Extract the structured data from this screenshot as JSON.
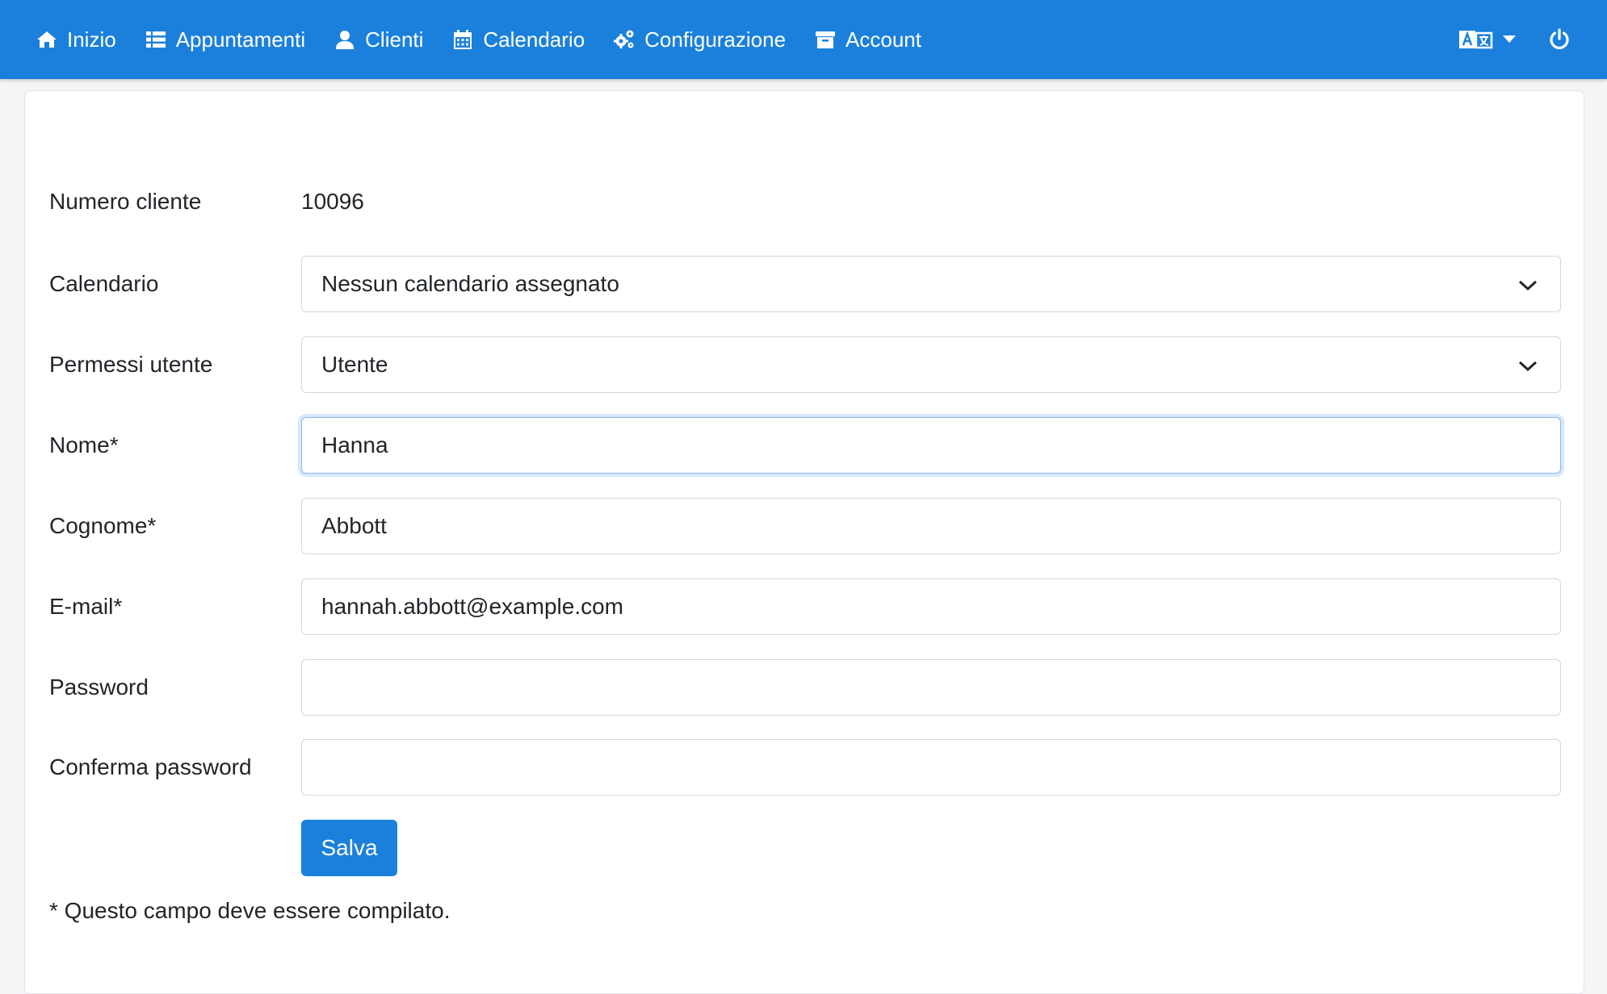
{
  "nav": {
    "items": [
      {
        "label": "Inizio",
        "icon": "home-icon"
      },
      {
        "label": "Appuntamenti",
        "icon": "list-icon"
      },
      {
        "label": "Clienti",
        "icon": "user-icon"
      },
      {
        "label": "Calendario",
        "icon": "calendar-icon"
      },
      {
        "label": "Configurazione",
        "icon": "cogs-icon"
      },
      {
        "label": "Account",
        "icon": "archive-icon"
      }
    ],
    "language_icon": "language-icon",
    "power_icon": "power-icon",
    "bar_color": "#1b80dc"
  },
  "form": {
    "customer_number_label": "Numero cliente",
    "customer_number_value": "10096",
    "calendar_label": "Calendario",
    "calendar_value": "Nessun calendario assegnato",
    "permissions_label": "Permessi utente",
    "permissions_value": "Utente",
    "first_name_label": "Nome*",
    "first_name_value": "Hanna",
    "last_name_label": "Cognome*",
    "last_name_value": "Abbott",
    "email_label": "E-mail*",
    "email_value": "hannah.abbott@example.com",
    "password_label": "Password",
    "password_value": "",
    "confirm_password_label": "Conferma password",
    "confirm_password_value": "",
    "save_label": "Salva",
    "required_note": "* Questo campo deve essere compilato."
  }
}
